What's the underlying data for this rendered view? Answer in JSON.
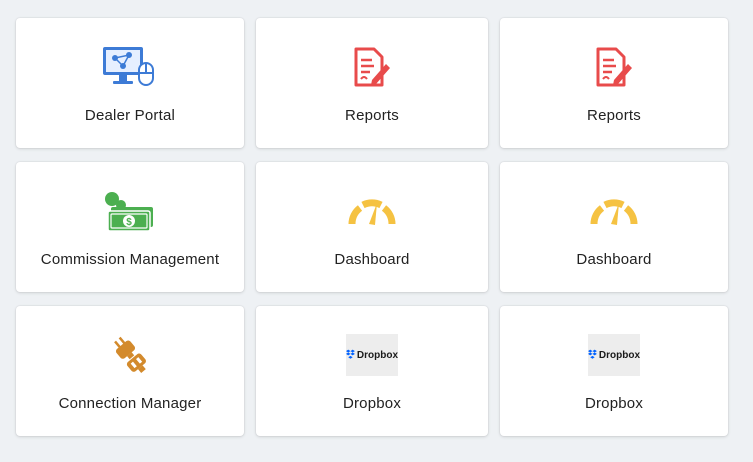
{
  "tiles": [
    {
      "label": "Dealer Portal",
      "icon": "dealer-portal-icon"
    },
    {
      "label": "Reports",
      "icon": "reports-icon"
    },
    {
      "label": "Reports",
      "icon": "reports-icon"
    },
    {
      "label": "Commission Management",
      "icon": "commission-money-icon"
    },
    {
      "label": "Dashboard",
      "icon": "dashboard-gauge-icon"
    },
    {
      "label": "Dashboard",
      "icon": "dashboard-gauge-icon"
    },
    {
      "label": "Connection Manager",
      "icon": "plug-connection-icon"
    },
    {
      "label": "Dropbox",
      "icon": "dropbox-logo"
    },
    {
      "label": "Dropbox",
      "icon": "dropbox-logo"
    }
  ],
  "dropbox_logo_text": "Dropbox",
  "colors": {
    "background": "#eef1f4",
    "portal_blue": "#3d7bd6",
    "reports_red": "#e84b4b",
    "money_green": "#4caf50",
    "gauge_yellow": "#f5c242",
    "plug_orange": "#d38a2c",
    "dropbox_blue": "#0061ff"
  }
}
